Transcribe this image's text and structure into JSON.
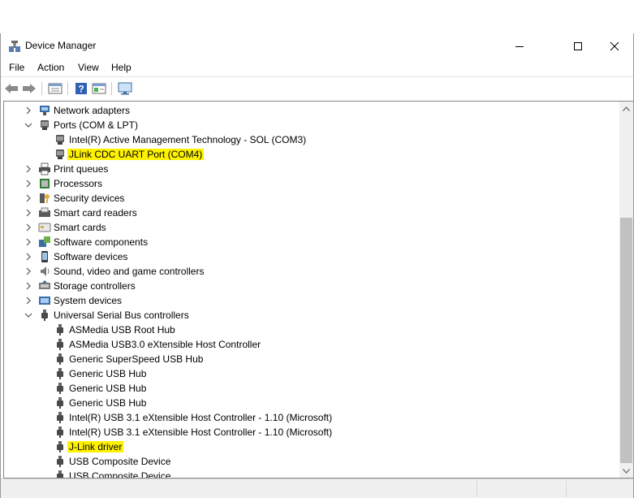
{
  "window": {
    "title": "Device Manager",
    "icon": "device-manager-icon"
  },
  "menu": [
    "File",
    "Action",
    "View",
    "Help"
  ],
  "toolbar": {
    "buttons": [
      "back-arrow-icon",
      "forward-arrow-icon",
      "properties-icon",
      "help-icon",
      "resources-icon",
      "monitor-icon"
    ]
  },
  "highlight_color": "#fff200",
  "tree": {
    "rows": [
      {
        "label": "Network adapters",
        "icon": "network-adapter-icon",
        "expander": "collapsed",
        "level": 0
      },
      {
        "label": "Ports (COM & LPT)",
        "icon": "port-icon",
        "expander": "expanded",
        "level": 0
      },
      {
        "label": "Intel(R) Active Management Technology - SOL (COM3)",
        "icon": "port-icon",
        "expander": "none",
        "level": 1
      },
      {
        "label": "JLink CDC UART Port (COM4)",
        "icon": "port-icon",
        "expander": "none",
        "level": 1,
        "highlighted": true
      },
      {
        "label": "Print queues",
        "icon": "printer-icon",
        "expander": "collapsed",
        "level": 0
      },
      {
        "label": "Processors",
        "icon": "processor-icon",
        "expander": "collapsed",
        "level": 0
      },
      {
        "label": "Security devices",
        "icon": "security-key-icon",
        "expander": "collapsed",
        "level": 0
      },
      {
        "label": "Smart card readers",
        "icon": "smart-card-reader-icon",
        "expander": "collapsed",
        "level": 0
      },
      {
        "label": "Smart cards",
        "icon": "smart-card-icon",
        "expander": "collapsed",
        "level": 0
      },
      {
        "label": "Software components",
        "icon": "software-component-icon",
        "expander": "collapsed",
        "level": 0
      },
      {
        "label": "Software devices",
        "icon": "software-device-icon",
        "expander": "collapsed",
        "level": 0
      },
      {
        "label": "Sound, video and game controllers",
        "icon": "speaker-icon",
        "expander": "collapsed",
        "level": 0
      },
      {
        "label": "Storage controllers",
        "icon": "storage-controller-icon",
        "expander": "collapsed",
        "level": 0
      },
      {
        "label": "System devices",
        "icon": "system-device-icon",
        "expander": "collapsed",
        "level": 0
      },
      {
        "label": "Universal Serial Bus controllers",
        "icon": "usb-icon",
        "expander": "expanded",
        "level": 0
      },
      {
        "label": "ASMedia USB Root Hub",
        "icon": "usb-icon",
        "expander": "none",
        "level": 1
      },
      {
        "label": "ASMedia USB3.0 eXtensible Host Controller",
        "icon": "usb-icon",
        "expander": "none",
        "level": 1
      },
      {
        "label": "Generic SuperSpeed USB Hub",
        "icon": "usb-icon",
        "expander": "none",
        "level": 1
      },
      {
        "label": "Generic USB Hub",
        "icon": "usb-icon",
        "expander": "none",
        "level": 1
      },
      {
        "label": "Generic USB Hub",
        "icon": "usb-icon",
        "expander": "none",
        "level": 1
      },
      {
        "label": "Generic USB Hub",
        "icon": "usb-icon",
        "expander": "none",
        "level": 1
      },
      {
        "label": "Intel(R) USB 3.1 eXtensible Host Controller - 1.10 (Microsoft)",
        "icon": "usb-icon",
        "expander": "none",
        "level": 1
      },
      {
        "label": "Intel(R) USB 3.1 eXtensible Host Controller - 1.10 (Microsoft)",
        "icon": "usb-icon",
        "expander": "none",
        "level": 1
      },
      {
        "label": "J-Link driver",
        "icon": "usb-icon",
        "expander": "none",
        "level": 1,
        "highlighted": true
      },
      {
        "label": "USB Composite Device",
        "icon": "usb-icon",
        "expander": "none",
        "level": 1
      },
      {
        "label": "USB Composite Device",
        "icon": "usb-icon",
        "expander": "none",
        "level": 1
      }
    ]
  }
}
